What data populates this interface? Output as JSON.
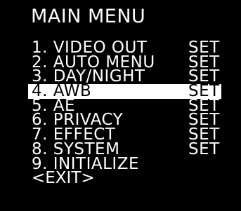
{
  "menu": {
    "title": "MAIN MENU",
    "items": [
      {
        "label": "1. VIDEO OUT",
        "value": "SET"
      },
      {
        "label": "2. AUTO MENU",
        "value": "SET"
      },
      {
        "label": "3. DAY/NIGHT",
        "value": "SET"
      },
      {
        "label": "4. AWB",
        "value": "SET"
      },
      {
        "label": "5. AE",
        "value": "SET"
      },
      {
        "label": "6. PRIVACY",
        "value": "SET"
      },
      {
        "label": "7. EFFECT",
        "value": "SET"
      },
      {
        "label": "8. SYSTEM",
        "value": "SET"
      },
      {
        "label": "9. INITIALIZE",
        "value": ""
      }
    ],
    "exit_label": "<EXIT>",
    "selected_index": 3
  },
  "colors": {
    "background": "#000000",
    "text": "#ffffff",
    "highlight_bg": "#ffffff",
    "highlight_text": "#000000"
  }
}
